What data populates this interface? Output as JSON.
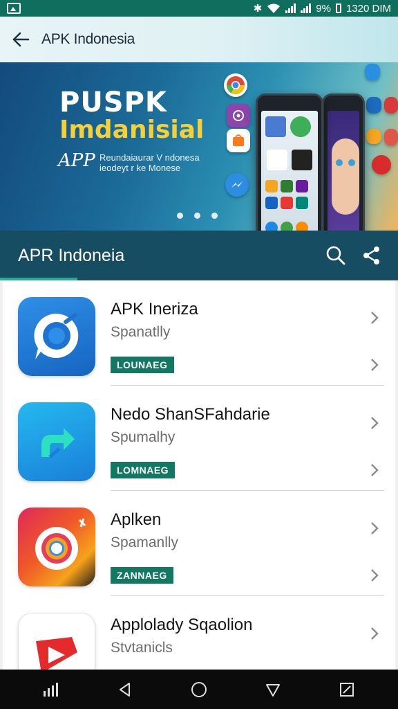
{
  "status_bar": {
    "battery_text": "9%",
    "time": "1320 DIM"
  },
  "header": {
    "title": "APK Indonesia"
  },
  "banner": {
    "title": "PUSPK",
    "subtitle": "Imdanisial",
    "app_label": "APP",
    "tagline_line1": "Reundaiaurar V ndonesa",
    "tagline_line2": "ieodeyt r ke Monese",
    "active_dot": 0,
    "dot_count": 3
  },
  "section": {
    "title": "APR Indoneia"
  },
  "apps": [
    {
      "name": "APK Ineriza",
      "category": "Spanatlly",
      "badge": "LOUNAEG",
      "icon": "chat-bubble-icon"
    },
    {
      "name": "Nedo ShanSFahdarie",
      "category": "Spumalhy",
      "badge": "LOMNAEG",
      "icon": "share-arrow-icon"
    },
    {
      "name": "Aplken",
      "category": "Spamanlly",
      "badge": "ZANNAEG",
      "icon": "ring-app-icon"
    },
    {
      "name": "Applolady Sqaolion",
      "category": "Stvtanicls",
      "badge": "",
      "icon": "play-icon"
    }
  ],
  "colors": {
    "status_bar": "#0f6e5d",
    "section_bar": "#174d63",
    "badge": "#137862",
    "accent": "#24b08a"
  }
}
